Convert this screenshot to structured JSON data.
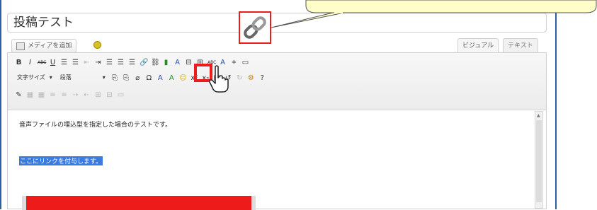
{
  "post": {
    "title": "投稿テスト"
  },
  "toolbar": {
    "add_media_label": "メディアを追加",
    "font_size_label": "文字サイズ",
    "format_label": "段落",
    "tab_visual": "ビジュアル",
    "tab_text": "テキスト"
  },
  "editor": {
    "paragraph_1": "音声ファイルの埋込型を指定した場合のテストです。",
    "paragraph_2": "ここにリンクを付与します。"
  },
  "icons": {
    "row1": [
      "B",
      "I",
      "ABC",
      "U",
      "≡",
      "≡",
      "⇤",
      "⇥",
      "≡",
      "≡",
      "≡",
      "link",
      "unlink",
      "≡",
      "A",
      "⊟",
      "⊞",
      "ABC",
      "A",
      "⌗",
      "▭"
    ],
    "row2": [
      "▾",
      "⎘",
      "⎘",
      "⌀",
      "Ω",
      "▭",
      "A",
      "A",
      "☺",
      "x²",
      "x₂",
      "▤",
      "↺",
      "↻",
      "⚙",
      "?"
    ]
  },
  "colors": {
    "highlight_red": "#ee1b1b",
    "selection_blue": "#3b7be0",
    "callout_fill": "#fffdc8",
    "frame_blue": "#2f5fa0"
  }
}
